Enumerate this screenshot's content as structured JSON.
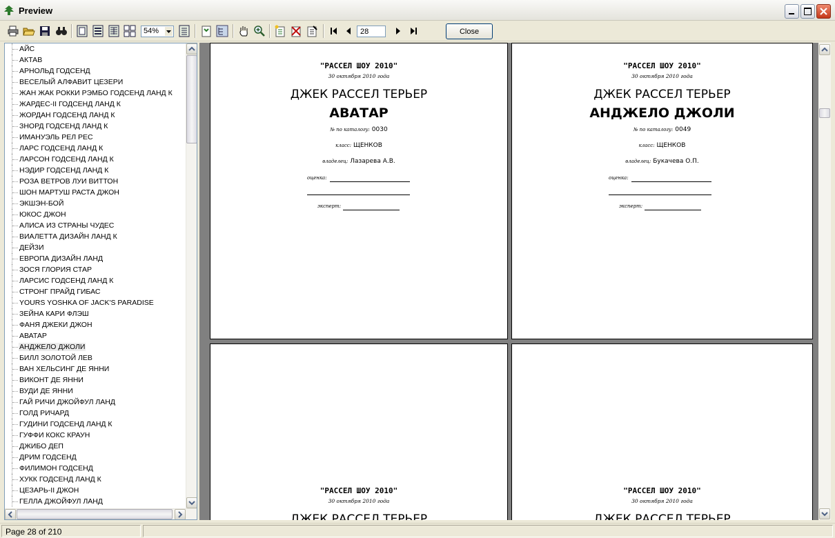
{
  "window": {
    "title": "Preview"
  },
  "toolbar": {
    "icons": [
      "printer-icon",
      "open-folder-icon",
      "save-disk-icon",
      "find-binoculars-icon",
      "one-page-icon",
      "two-pages-icon",
      "four-pages-icon",
      "multi-page-icon",
      "page-setup-icon",
      "outline-icon",
      "tree-toggle-icon",
      "hand-icon",
      "zoom-in-icon",
      "add-page-icon",
      "delete-page-icon",
      "edit-page-icon",
      "first-page-icon",
      "prev-page-icon",
      "next-page-icon",
      "last-page-icon"
    ],
    "zoom_value": "54%",
    "page_number": "28",
    "close_label": "Close"
  },
  "tree": {
    "items": [
      "АЙС",
      "АКТАВ",
      "АРНОЛЬД ГОДСЕНД",
      "ВЕСЕЛЫЙ АЛФАВИТ ЦЕЗЕРИ",
      "ЖАН ЖАК РОККИ РЭМБО ГОДСЕНД ЛАНД К",
      "ЖАРДЕС-II ГОДСЕНД ЛАНД К",
      "ЖОРДАН ГОДСЕНД ЛАНД К",
      "ЗНОРД ГОДСЕНД ЛАНД К",
      "ИМАНУЭЛЬ РЕЛ РЕС",
      "ЛАРС ГОДСЕНД ЛАНД К",
      "ЛАРСОН ГОДСЕНД ЛАНД К",
      "НЭДИР ГОДСЕНД ЛАНД К",
      "РОЗА ВЕТРОВ ЛУИ ВИТТОН",
      "ШОН МАРТУШ РАСТА ДЖОН",
      "ЭКШЭН-БОЙ",
      "ЮКОС ДЖОН",
      "АЛИСА ИЗ СТРАНЫ ЧУДЕС",
      "ВИАЛЕТТА ДИЗАЙН ЛАНД К",
      "ДЕЙЗИ",
      "ЕВРОПА ДИЗАЙН ЛАНД",
      "ЗОСЯ ГЛОРИЯ СТАР",
      "ЛАРСИС ГОДСЕНД ЛАНД К",
      "СТРОНГ ПРАЙД ГИБАС",
      "YOURS YOSHKA OF JACK'S PARADISE",
      "ЗЕЙНА КАРИ ФЛЭШ",
      "ФАНЯ ДЖЕКИ ДЖОН",
      "АВАТАР",
      "АНДЖЕЛО ДЖОЛИ",
      "БИЛЛ ЗОЛОТОЙ ЛЕВ",
      "ВАН ХЕЛЬСИНГ ДЕ ЯННИ",
      "ВИКОНТ ДЕ ЯННИ",
      "ВУДИ ДЕ ЯННИ",
      "ГАЙ РИЧИ ДЖОЙФУЛ ЛАНД",
      "ГОЛД РИЧАРД",
      "ГУДИНИ ГОДСЕНД ЛАНД К",
      "ГУФФИ КОКС КРАУН",
      "ДЖИБО ДЕП",
      "ДРИМ ГОДСЕНД",
      "ФИЛИМОН ГОДСЕНД",
      "ХУКК ГОДСЕНД ЛАНД К",
      "ЦЕЗАРЬ-II ДЖОН",
      "ГЕЛЛА ДЖОЙФУЛ ЛАНД"
    ],
    "selected_index": 27
  },
  "pages": [
    {
      "show": "\"РАССЕЛ ШОУ 2010\"",
      "date": "30 октября 2010 года",
      "breed": "ДЖЕК РАССЕЛ ТЕРЬЕР",
      "dog": "АВАТАР",
      "catalog_label": "№ по каталогу:",
      "catalog": "0030",
      "class_label": "класс:",
      "class": "ЩЕНКОВ",
      "owner_label": "владелец:",
      "owner": "Лазарева А.В.",
      "grade_label": "оценка:",
      "expert_label": "эксперт:"
    },
    {
      "show": "\"РАССЕЛ ШОУ 2010\"",
      "date": "30 октября 2010 года",
      "breed": "ДЖЕК РАССЕЛ ТЕРЬЕР",
      "dog": "АНДЖЕЛО ДЖОЛИ",
      "catalog_label": "№ по каталогу:",
      "catalog": "0049",
      "class_label": "класс:",
      "class": "ЩЕНКОВ",
      "owner_label": "владелец:",
      "owner": "Букачева О.П.",
      "grade_label": "оценка:",
      "expert_label": "эксперт:"
    },
    {
      "show": "\"РАССЕЛ ШОУ 2010\"",
      "date": "30 октября 2010 года",
      "breed": "ДЖЕК РАССЕЛ ТЕРЬЕР"
    },
    {
      "show": "\"РАССЕЛ ШОУ 2010\"",
      "date": "30 октября 2010 года",
      "breed": "ДЖЕК РАССЕЛ ТЕРЬЕР"
    }
  ],
  "status": {
    "page_info": "Page 28 of 210"
  }
}
